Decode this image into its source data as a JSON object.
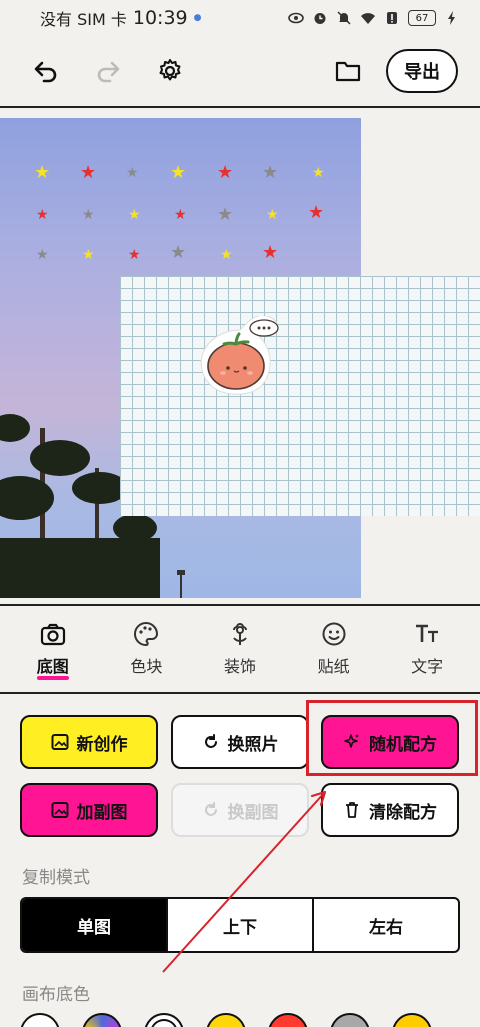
{
  "status_bar": {
    "carrier": "没有 SIM 卡",
    "time": "10:39",
    "battery": "67"
  },
  "toolbar": {
    "undo_icon": "undo-icon",
    "redo_icon": "redo-icon",
    "settings_icon": "gear-icon",
    "folder_icon": "folder-icon",
    "export_label": "导出"
  },
  "tabs": [
    {
      "label": "底图",
      "icon": "camera-icon",
      "active": true
    },
    {
      "label": "色块",
      "icon": "palette-icon",
      "active": false
    },
    {
      "label": "装饰",
      "icon": "flower-icon",
      "active": false
    },
    {
      "label": "贴纸",
      "icon": "smiley-icon",
      "active": false
    },
    {
      "label": "文字",
      "icon": "text-size-icon",
      "active": false
    }
  ],
  "actions": {
    "new_creation": "新创作",
    "change_photo": "换照片",
    "random_recipe": "随机配方",
    "add_sub_image": "加副图",
    "change_sub_image": "换副图",
    "clear_recipe": "清除配方"
  },
  "copy_mode": {
    "label": "复制模式",
    "options": [
      "单图",
      "上下",
      "左右"
    ],
    "selected": "单图"
  },
  "canvas_color": {
    "label": "画布底色",
    "colors": [
      "#ffffff",
      "#4f6bd8",
      "#ffffff",
      "#ffd60a",
      "#ff3b30",
      "#a8a8a8",
      "#ffcc00"
    ]
  },
  "colors": {
    "accent_pink": "#ff1493",
    "accent_yellow": "#ffee22",
    "annotation_red": "#d9232c"
  }
}
